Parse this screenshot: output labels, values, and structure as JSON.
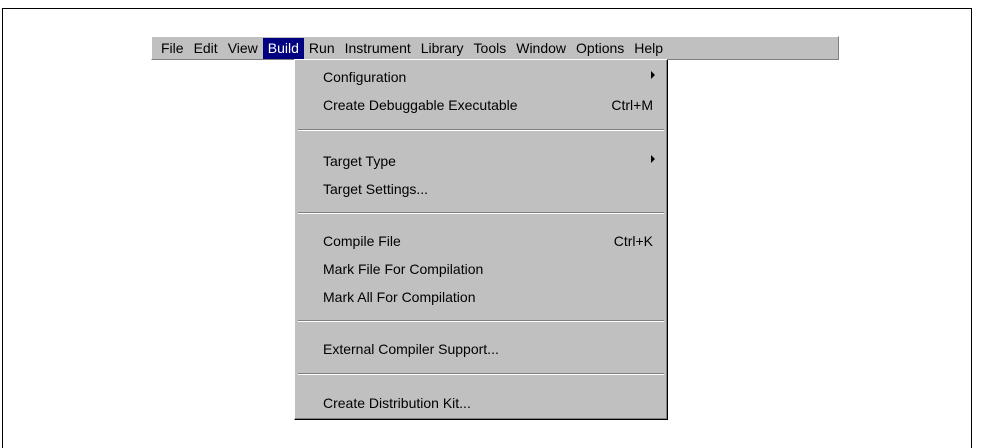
{
  "menubar": {
    "items": [
      "File",
      "Edit",
      "View",
      "Build",
      "Run",
      "Instrument",
      "Library",
      "Tools",
      "Window",
      "Options",
      "Help"
    ],
    "active": "Build"
  },
  "build_menu": {
    "items": [
      {
        "label": "Configuration",
        "submenu": true
      },
      {
        "label": "Create Debuggable Executable",
        "shortcut": "Ctrl+M"
      },
      {
        "label": "Target Type",
        "submenu": true
      },
      {
        "label": "Target Settings..."
      },
      {
        "label": "Compile File",
        "shortcut": "Ctrl+K"
      },
      {
        "label": "Mark File For Compilation"
      },
      {
        "label": "Mark All For Compilation"
      },
      {
        "label": "External Compiler Support..."
      },
      {
        "label": "Create Distribution Kit..."
      }
    ]
  }
}
